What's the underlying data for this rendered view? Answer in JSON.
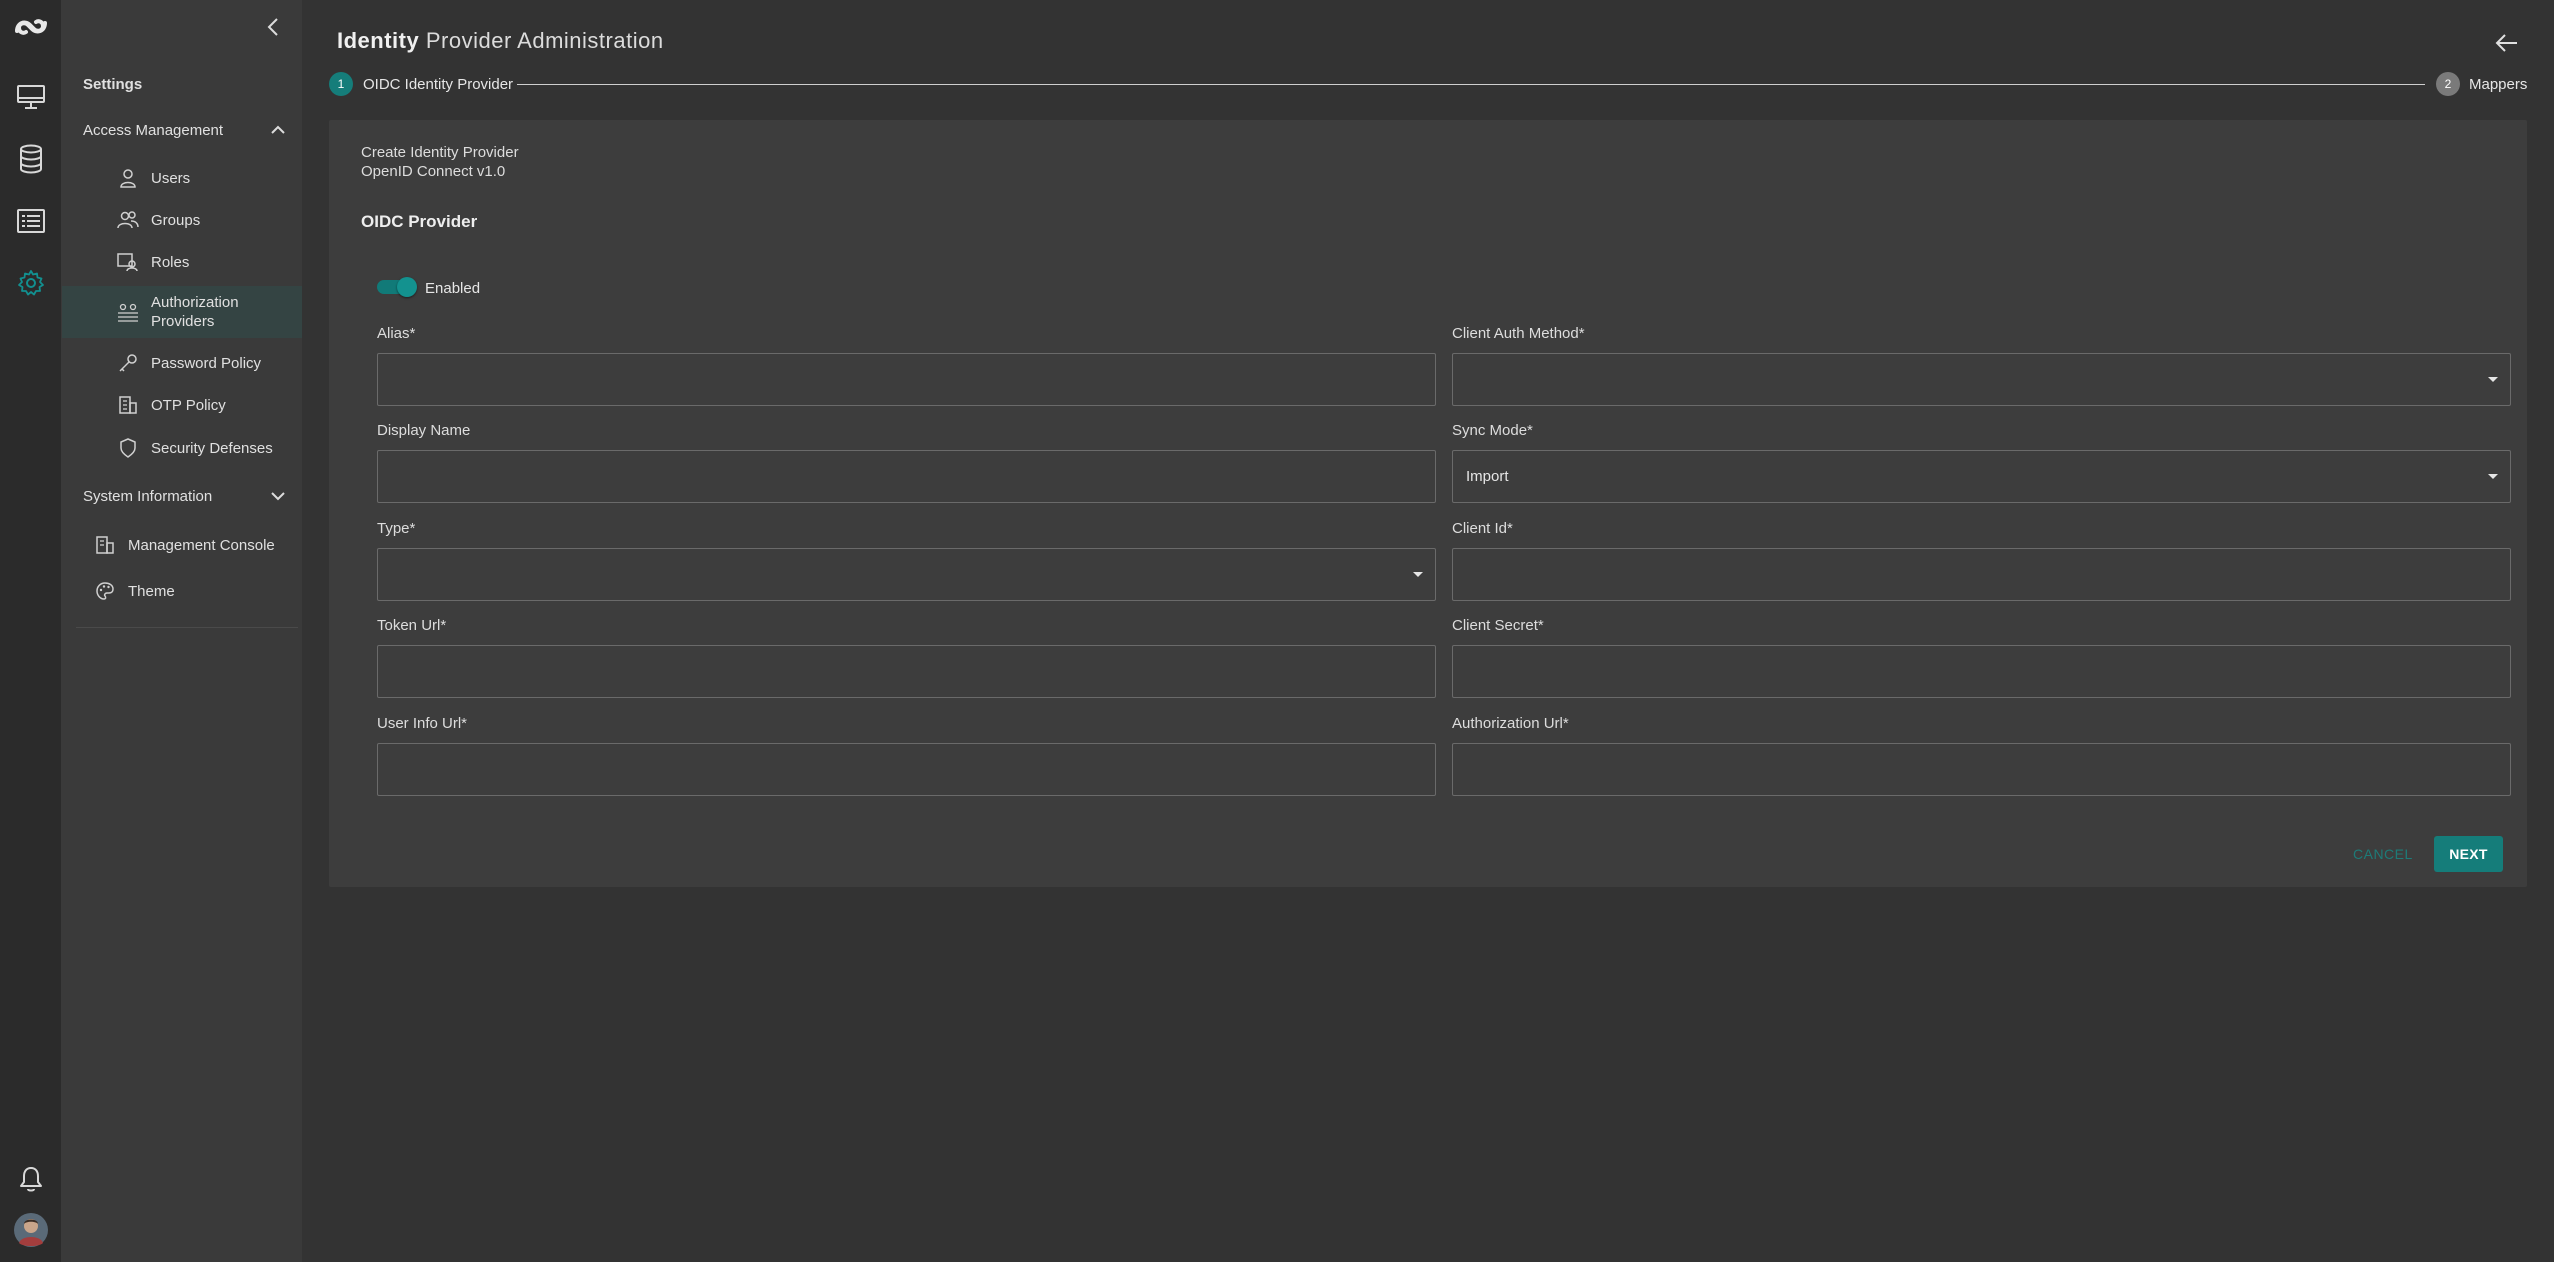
{
  "colors": {
    "accent": "#157d7a",
    "background": "#333333",
    "sidebar": "#3a3a3a",
    "rail": "#2b2b2b",
    "card": "#3d3d3d",
    "active_item": "#344443"
  },
  "rail": {
    "items": [
      {
        "icon": "logo-icon"
      },
      {
        "icon": "monitor-icon"
      },
      {
        "icon": "database-icon"
      },
      {
        "icon": "list-icon"
      },
      {
        "icon": "gear-icon"
      },
      {
        "icon": "bell-icon"
      },
      {
        "icon": "avatar"
      }
    ]
  },
  "sidebar": {
    "collapse_icon": "chevron-left-icon",
    "heading": "Settings",
    "groups": [
      {
        "label": "Access Management",
        "expanded": true,
        "items": [
          {
            "label": "Users",
            "icon": "user-icon"
          },
          {
            "label": "Groups",
            "icon": "groups-icon"
          },
          {
            "label": "Roles",
            "icon": "roles-icon"
          },
          {
            "label": "Authorization",
            "label2": "Providers",
            "icon": "authorization-providers-icon",
            "active": true
          },
          {
            "label": "Password Policy",
            "icon": "key-icon"
          },
          {
            "label": "OTP Policy",
            "icon": "otp-policy-icon"
          },
          {
            "label": "Security Defenses",
            "icon": "shield-icon"
          }
        ]
      },
      {
        "label": "System Information",
        "expanded": false,
        "items": []
      }
    ],
    "extra_items": [
      {
        "label": "Management Console",
        "icon": "management-console-icon"
      },
      {
        "label": "Theme",
        "icon": "palette-icon"
      }
    ]
  },
  "header": {
    "title_bold": "Identity",
    "title_rest": "Provider Administration",
    "back_icon": "arrow-left-icon"
  },
  "stepper": {
    "steps": [
      {
        "number": "1",
        "label": "OIDC Identity Provider",
        "active": true
      },
      {
        "number": "2",
        "label": "Mappers",
        "active": false
      }
    ]
  },
  "form": {
    "subtitle_line1": "Create Identity Provider",
    "subtitle_line2": "OpenID Connect v1.0",
    "title": "OIDC Provider",
    "enabled_label": "Enabled",
    "enabled": true,
    "fields": {
      "alias": {
        "label": "Alias*",
        "value": ""
      },
      "client_auth_method": {
        "label": "Client Auth Method*",
        "value": ""
      },
      "display_name": {
        "label": "Display Name",
        "value": ""
      },
      "sync_mode": {
        "label": "Sync Mode*",
        "value": "Import"
      },
      "type": {
        "label": "Type*",
        "value": ""
      },
      "client_id": {
        "label": "Client Id*",
        "value": ""
      },
      "token_url": {
        "label": "Token Url*",
        "value": ""
      },
      "client_secret": {
        "label": "Client Secret*",
        "value": ""
      },
      "user_info_url": {
        "label": "User Info Url*",
        "value": ""
      },
      "authorization_url": {
        "label": "Authorization Url*",
        "value": ""
      }
    },
    "cancel_label": "CANCEL",
    "next_label": "NEXT"
  }
}
